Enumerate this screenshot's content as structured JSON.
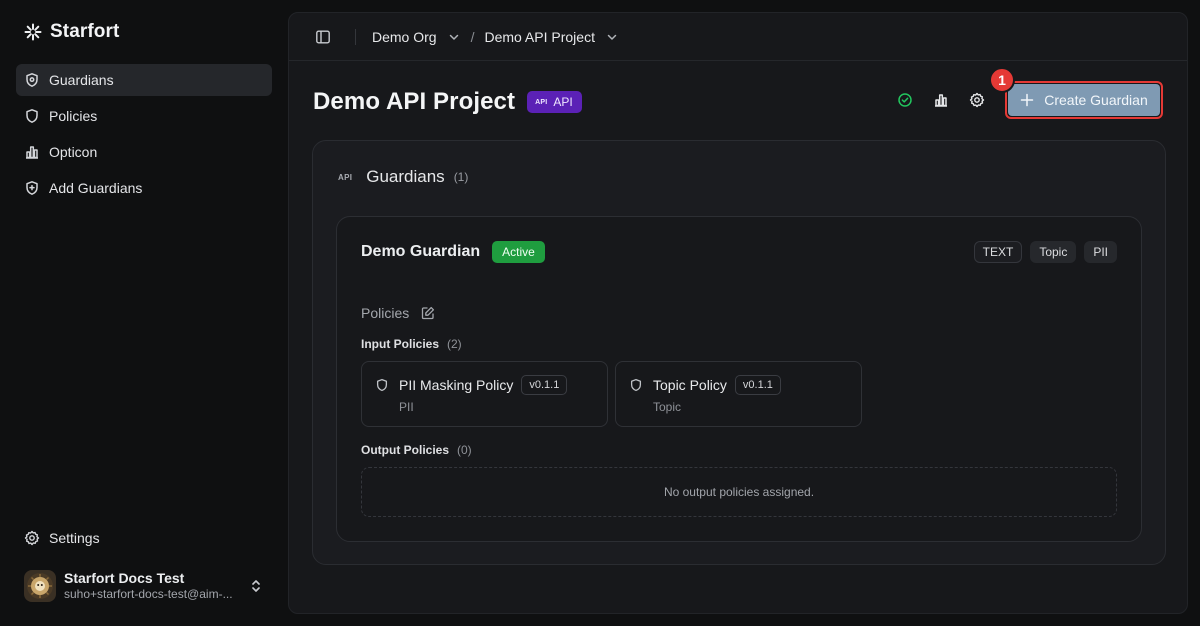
{
  "app": {
    "name": "Starfort"
  },
  "sidebar": {
    "items": [
      {
        "label": "Guardians",
        "icon": "shield-icon",
        "active": true
      },
      {
        "label": "Policies",
        "icon": "shield-icon",
        "active": false
      },
      {
        "label": "Opticon",
        "icon": "bar-chart-icon",
        "active": false
      },
      {
        "label": "Add Guardians",
        "icon": "shield-plus-icon",
        "active": false
      }
    ],
    "settings_label": "Settings",
    "user": {
      "name": "Starfort Docs Test",
      "email": "suho+starfort-docs-test@aim-..."
    }
  },
  "breadcrumb": {
    "org": "Demo Org",
    "project": "Demo API Project",
    "separator": "/"
  },
  "header": {
    "title": "Demo API Project",
    "badge_label": "API",
    "badge_mini": "API",
    "create_button_label": "Create Guardian",
    "callout_number": "1"
  },
  "guardians_section": {
    "mini_label": "API",
    "title": "Guardians",
    "count": "(1)"
  },
  "guardian": {
    "name": "Demo Guardian",
    "status": "Active",
    "tags": [
      "TEXT",
      "Topic",
      "PII"
    ],
    "policies_label": "Policies",
    "input_policies_label": "Input Policies",
    "input_count": "(2)",
    "input_policies": [
      {
        "name": "PII Masking Policy",
        "version": "v0.1.1",
        "type": "PII"
      },
      {
        "name": "Topic Policy",
        "version": "v0.1.1",
        "type": "Topic"
      }
    ],
    "output_policies_label": "Output Policies",
    "output_count": "(0)",
    "output_empty_text": "No output policies assigned."
  },
  "colors": {
    "accent_button": "#7f9ab3",
    "callout": "#e53935",
    "status_active": "#1f9d3f",
    "api_badge": "#5b21b6",
    "health_ok": "#22c55e"
  }
}
